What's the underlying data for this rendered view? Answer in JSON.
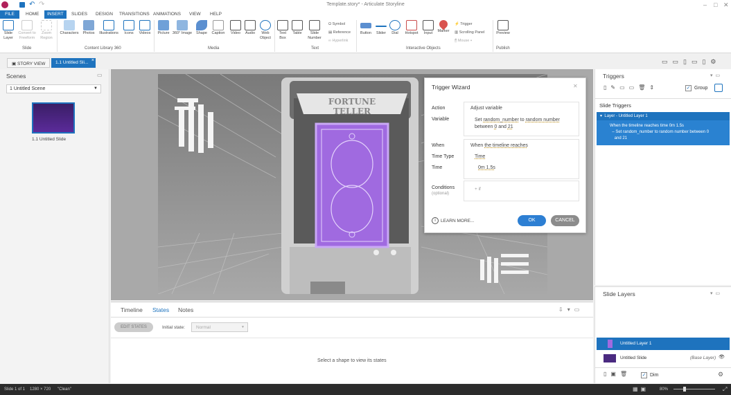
{
  "window": {
    "title": "Template.story* - Articulate Storyline"
  },
  "tabs": [
    {
      "label": "FILE"
    },
    {
      "label": "HOME"
    },
    {
      "label": "INSERT"
    },
    {
      "label": "SLIDES"
    },
    {
      "label": "DESIGN"
    },
    {
      "label": "TRANSITIONS"
    },
    {
      "label": "ANIMATIONS"
    },
    {
      "label": "VIEW"
    },
    {
      "label": "HELP"
    }
  ],
  "ribbon": {
    "slide_layer": "Slide\nLayer",
    "convert": "Convert to\nFreeform",
    "zoom_region": "Zoom\nRegion",
    "characters": "Characters",
    "photos": "Photos",
    "illustrations": "Illustrations",
    "icons": "Icons",
    "videos": "Videos",
    "picture": "Picture",
    "image360": "360° Image",
    "shape": "Shape",
    "caption": "Caption",
    "video": "Video",
    "audio": "Audio",
    "web_object": "Web\nObject",
    "text_box": "Text\nBox",
    "table": "Table",
    "slide_number": "Slide\nNumber",
    "symbol": "Symbol",
    "reference": "Reference",
    "hyperlink": "Hyperlink",
    "button": "Button",
    "slider": "Slider",
    "dial": "Dial",
    "hotspot": "Hotspot",
    "input": "Input",
    "marker": "Marker",
    "trigger": "Trigger",
    "scrolling_panel": "Scrolling Panel",
    "mouse": "Mouse",
    "preview": "Preview",
    "groups": {
      "slide": "Slide",
      "content_library": "Content Library 360",
      "media": "Media",
      "text": "Text",
      "interactive": "Interactive Objects",
      "publish": "Publish"
    }
  },
  "doctabs": {
    "story_view": "STORY VIEW",
    "current": "1.1 Untitled Sli..."
  },
  "scenes": {
    "title": "Scenes",
    "selected_scene": "1 Untitled Scene",
    "slide_label": "1.1 Untitled Slide"
  },
  "slide": {
    "banner": "FORTUNE TELLER"
  },
  "wizard": {
    "title": "Trigger Wizard",
    "action_label": "Action",
    "action_value": "Adjust variable",
    "variable_label": "Variable",
    "variable_line1_pre": "Set ",
    "variable_name": "random_number",
    "variable_line1_mid": " to ",
    "variable_mode": "random number",
    "variable_line2_pre": "between ",
    "min": "0",
    "and": " and ",
    "max": "21",
    "when_label": "When",
    "when_pre": "When ",
    "when_value": "the timeline reaches",
    "time_type_label": "Time Type",
    "time_type_value": "Time",
    "time_label": "Time",
    "time_value": "0m 1.5s",
    "conditions_label": "Conditions",
    "conditions_optional": "(optional)",
    "add_if": "+ if",
    "learn_more": "LEARN MORE...",
    "ok": "OK",
    "cancel": "CANCEL"
  },
  "bottom": {
    "tab_timeline": "Timeline",
    "tab_states": "States",
    "tab_notes": "Notes",
    "edit_states": "EDIT STATES",
    "initial_state_label": "Initial state:",
    "initial_state_value": "Normal",
    "empty_msg": "Select a shape to view its states"
  },
  "triggers": {
    "title": "Triggers",
    "group_label": "Group",
    "section": "Slide Triggers",
    "layer_header": "Layer - Untitled Layer 1",
    "trigger_line": "When the timeline reaches time 0m 1.5s",
    "trigger_sub1": "Set random_number to random number between 0",
    "trigger_sub2": "and 21"
  },
  "layers": {
    "title": "Slide Layers",
    "layer1": "Untitled Layer 1",
    "base": "Untitled Slide",
    "base_tag": "(Base Layer)",
    "dim": "Dim"
  },
  "status": {
    "slide": "Slide 1 of 1",
    "size": "1280 × 720",
    "theme": "\"Clean\"",
    "zoom": "80%"
  },
  "colors": {
    "accent": "#1e73be",
    "card": "#8a4fd8",
    "ok": "#2d7fd3",
    "cancel": "#8c8c8c"
  }
}
